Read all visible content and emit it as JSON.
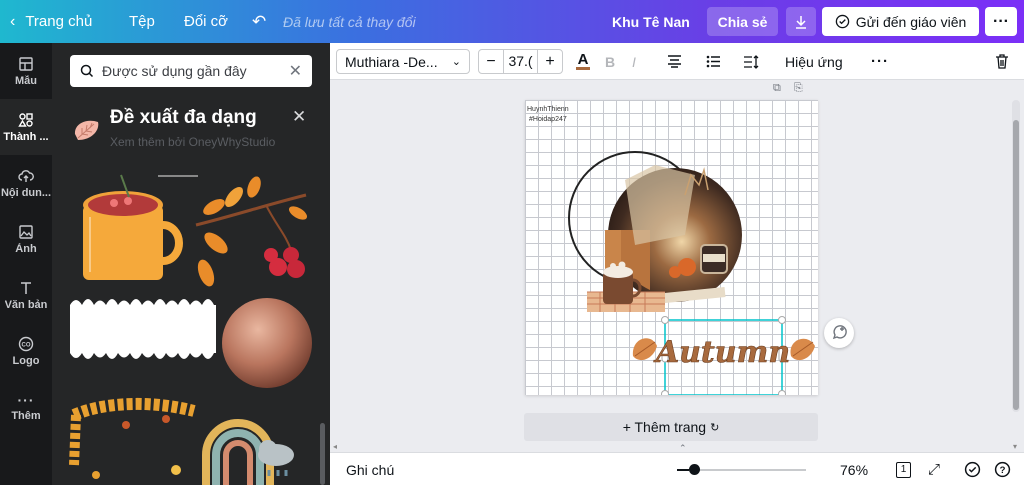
{
  "topbar": {
    "home_label": "Trang chủ",
    "file_label": "Tệp",
    "resize_label": "Đổi cỡ",
    "saved_status": "Đã lưu tất cả thay đổi",
    "user_name": "Khu Tê Nan",
    "share_label": "Chia sẻ",
    "send_label": "Gửi đến giáo viên"
  },
  "rail": {
    "items": [
      {
        "label": "Mẫu",
        "icon": "template-icon"
      },
      {
        "label": "Thành ...",
        "icon": "elements-icon"
      },
      {
        "label": "Nội dun...",
        "icon": "upload-icon"
      },
      {
        "label": "Ảnh",
        "icon": "photo-icon"
      },
      {
        "label": "Văn bản",
        "icon": "text-icon"
      },
      {
        "label": "Logo",
        "icon": "logo-icon"
      },
      {
        "label": "Thêm",
        "icon": "more-icon"
      }
    ]
  },
  "panel": {
    "search_value": "Được sử dụng gần đây",
    "suggestion_title": "Đề xuất đa dạng",
    "suggestion_sub": "Xem thêm bởi OneyWhyStudio"
  },
  "toolbar": {
    "font_name": "Muthiara -De...",
    "font_size": "37.(",
    "effects_label": "Hiệu ứng"
  },
  "canvas": {
    "credit_line1": "HuynhThienn",
    "credit_line2": "#Hoidap247",
    "title_text": "Autumn",
    "add_page_label": "+ Thêm trang"
  },
  "bottom": {
    "notes_label": "Ghi chú",
    "zoom_value": "76%",
    "page_count": "1"
  },
  "colors": {
    "accent": "#00c4cc",
    "autumn_brown": "#a86a3e",
    "gradient_start": "#1fb8cf",
    "gradient_end": "#7b2ff7"
  }
}
